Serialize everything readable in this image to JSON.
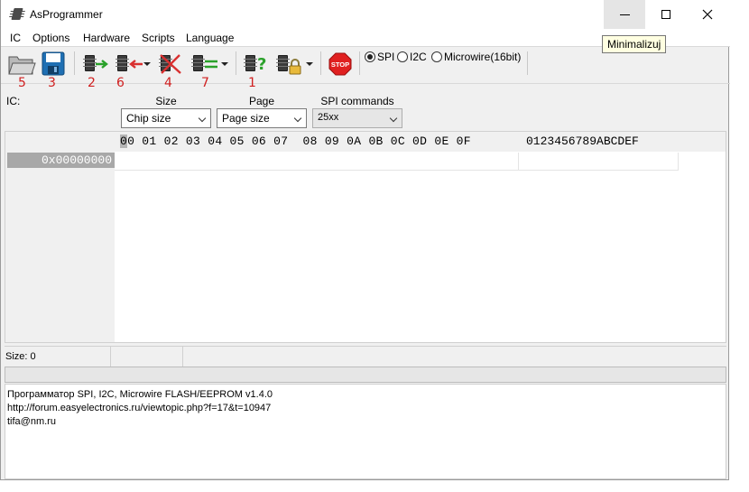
{
  "window": {
    "title": "AsProgrammer"
  },
  "tooltip": {
    "text": "Minimalizuj"
  },
  "menu": [
    "IC",
    "Options",
    "Hardware",
    "Scripts",
    "Language"
  ],
  "toolbar": {
    "annotations": [
      "5",
      "3",
      "2",
      "6",
      "4",
      "7",
      "1"
    ],
    "stop_label": "STOP",
    "protocols": [
      {
        "label": "SPI",
        "selected": true
      },
      {
        "label": "I2C",
        "selected": false
      },
      {
        "label": "Microwire(16bit)",
        "selected": false
      }
    ]
  },
  "ic": {
    "label": "IC:",
    "size_label": "Size",
    "page_label": "Page",
    "spi_label": "SPI commands",
    "size_value": "Chip size",
    "page_value": "Page size",
    "spi_value": "25xx"
  },
  "hex": {
    "columns": "00 01 02 03 04 05 06 07  08 09 0A 0B 0C 0D 0E 0F",
    "ascii_header": "0123456789ABCDEF",
    "address": "0x00000000"
  },
  "status": {
    "size": "Size: 0"
  },
  "log": [
    "Программатор SPI, I2C, Microwire FLASH/EEPROM v1.4.0",
    "http://forum.easyelectronics.ru/viewtopic.php?f=17&t=10947",
    "tifa@nm.ru"
  ],
  "colors": {
    "annotation": "#d01f1f",
    "stop": "#e02020",
    "check": "#2aa12a"
  }
}
